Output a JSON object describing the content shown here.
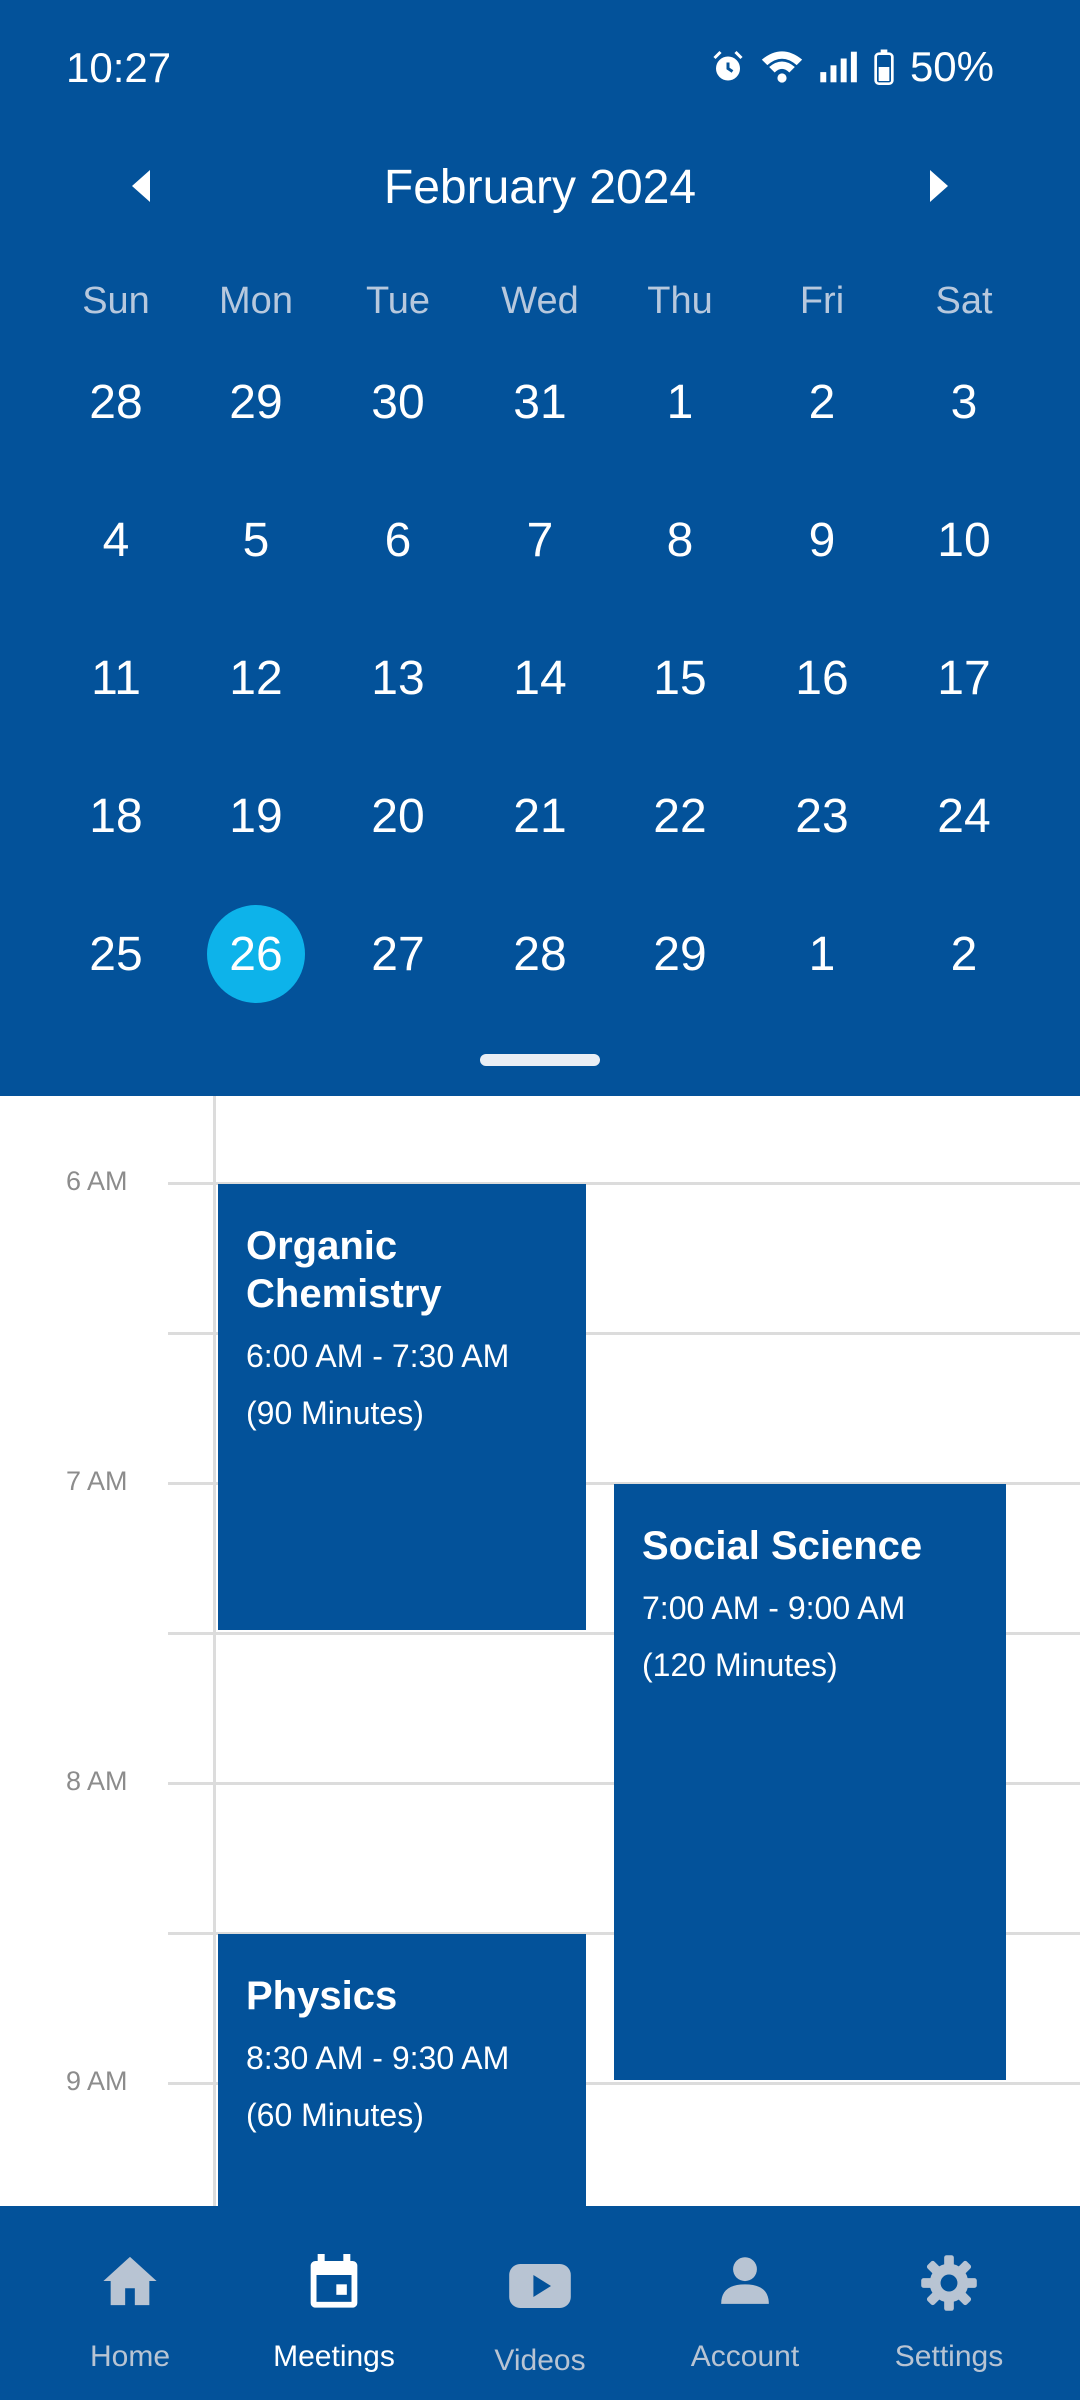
{
  "status_bar": {
    "time": "10:27",
    "battery": "50%"
  },
  "calendar": {
    "month_title": "February 2024",
    "weekdays": [
      "Sun",
      "Mon",
      "Tue",
      "Wed",
      "Thu",
      "Fri",
      "Sat"
    ],
    "weeks": [
      [
        "28",
        "29",
        "30",
        "31",
        "1",
        "2",
        "3"
      ],
      [
        "4",
        "5",
        "6",
        "7",
        "8",
        "9",
        "10"
      ],
      [
        "11",
        "12",
        "13",
        "14",
        "15",
        "16",
        "17"
      ],
      [
        "18",
        "19",
        "20",
        "21",
        "22",
        "23",
        "24"
      ],
      [
        "25",
        "26",
        "27",
        "28",
        "29",
        "1",
        "2"
      ]
    ],
    "selected_day": "26",
    "selected_color": "#0db3ea"
  },
  "schedule": {
    "time_labels": [
      "6 AM",
      "7 AM",
      "8 AM",
      "9 AM"
    ],
    "events": [
      {
        "title": "Organic Chemistry",
        "time": "6:00 AM - 7:30 AM",
        "duration": "(90 Minutes)"
      },
      {
        "title": "Social Science",
        "time": "7:00 AM - 9:00 AM",
        "duration": "(120 Minutes)"
      },
      {
        "title": "Physics",
        "time": "8:30 AM - 9:30 AM",
        "duration": "(60 Minutes)"
      }
    ]
  },
  "bottom_nav": {
    "items": [
      {
        "label": "Home",
        "icon": "home-icon"
      },
      {
        "label": "Meetings",
        "icon": "calendar-icon",
        "active": true
      },
      {
        "label": "Videos",
        "icon": "youtube-icon"
      },
      {
        "label": "Account",
        "icon": "person-icon"
      },
      {
        "label": "Settings",
        "icon": "gear-icon"
      }
    ]
  },
  "colors": {
    "primary": "#03529a",
    "accent": "#0db3ea"
  }
}
